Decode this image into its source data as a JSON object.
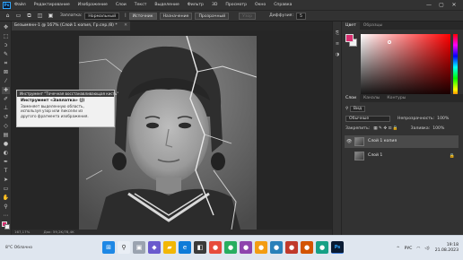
{
  "app": {
    "logo": "Ps",
    "menu": [
      "Файл",
      "Редактирование",
      "Изображение",
      "Слои",
      "Текст",
      "Выделение",
      "Фильтр",
      "3D",
      "Просмотр",
      "Окно",
      "Справка"
    ]
  },
  "window_controls": {
    "minimize": "—",
    "maximize": "▢",
    "close": "✕"
  },
  "options_bar": {
    "tool_icon": "patch-tool-icon",
    "mode_label": "Заплатка:",
    "mode_value": "Нормальный",
    "source_button": "Источник",
    "dest_button": "Назначение",
    "transparent_button": "Прозрачный",
    "use_pattern_button": "Узор",
    "diffusion_label": "Диффузия:",
    "diffusion_value": "5"
  },
  "document": {
    "tab_title": "Безымянн-1 @ 167% (Слой 1 копия, Гр.сер./8) *",
    "close": "✕"
  },
  "tooltip": {
    "header": "Инструмент \"Точечная восстанавливающая кисть\"",
    "title": "Инструмент «Заплатка» (J)",
    "description": "Заменяет выделенную область, используя узор или пиксели из другого фрагмента изображения."
  },
  "status_bar": {
    "zoom": "167,17%",
    "doc_size": "Док: 59,2K/78,4K"
  },
  "color_panel": {
    "tabs": [
      "Цвет",
      "Образцы"
    ],
    "foreground": "#d72f6f",
    "background": "#f2f2f2"
  },
  "layers_panel": {
    "tabs": [
      "Слои",
      "Каналы",
      "Контуры"
    ],
    "filter_label": "Вид",
    "blend_mode": "Обычные",
    "opacity_label": "Непрозрачность:",
    "opacity_value": "100%",
    "lock_label": "Закрепить:",
    "fill_label": "Заливка:",
    "fill_value": "100%",
    "layers": [
      {
        "name": "Слой 1 копия",
        "visible": true,
        "selected": true,
        "locked": false
      },
      {
        "name": "Слой 1",
        "visible": false,
        "selected": false,
        "locked": true
      }
    ]
  },
  "taskbar": {
    "weather": "8°C Облачно",
    "lang": "РУС",
    "time": "19:18",
    "date": "21.08.2023"
  }
}
